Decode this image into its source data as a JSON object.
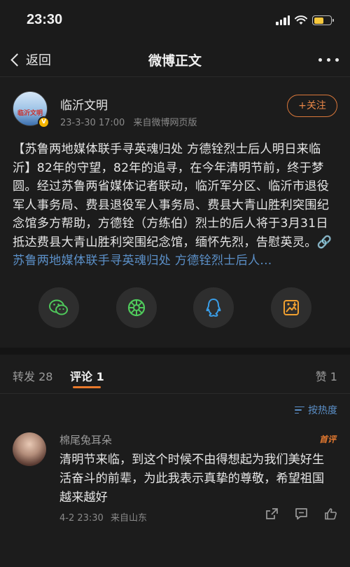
{
  "status": {
    "time": "23:30",
    "battery_level": 0.6,
    "battery_color": "#f6c83d"
  },
  "nav": {
    "back_label": "返回",
    "title": "微博正文"
  },
  "author": {
    "name": "临沂文明",
    "date": "23-3-30 17:00",
    "source": "来自微博网页版",
    "avatar_text": "临沂文明",
    "follow_label": "+关注"
  },
  "post": {
    "text": "【苏鲁两地媒体联手寻英魂归处 方德铨烈士后人明日来临沂】82年的守望，82年的追寻，在今年清明节前，终于梦圆。经过苏鲁两省媒体记者联动，临沂军分区、临沂市退役军人事务局、费县退役军人事务局、费县大青山胜利突围纪念馆多方帮助，方德铨（方练伯）烈士的后人将于3月31日抵达费县大青山胜利突围纪念馆，缅怀先烈，告慰英灵。",
    "link_text": "🔗苏鲁两地媒体联手寻英魂归处 方德铨烈士后人..."
  },
  "share": {
    "items": [
      {
        "icon": "wechat-icon",
        "color": "#4fc95b"
      },
      {
        "icon": "moments-icon",
        "color": "#4fc95b"
      },
      {
        "icon": "qq-icon",
        "color": "#3a9ee8"
      },
      {
        "icon": "save-image-icon",
        "color": "#f0a030"
      }
    ]
  },
  "tabs": {
    "repost_label": "转发 28",
    "comment_label": "评论 1",
    "like_label": "赞 1"
  },
  "sort": {
    "label": "按热度"
  },
  "comment": {
    "name": "棉尾兔耳朵",
    "badge": "首评",
    "text": "清明节来临，到这个时候不由得想起为我们美好生活奋斗的前辈，为此我表示真挚的尊敬，希望祖国越来越好",
    "date": "4-2 23:30",
    "location": "来自山东"
  },
  "colors": {
    "accent": "#e8792c",
    "link": "#5b8fc7",
    "background": "#1c1c1c"
  }
}
